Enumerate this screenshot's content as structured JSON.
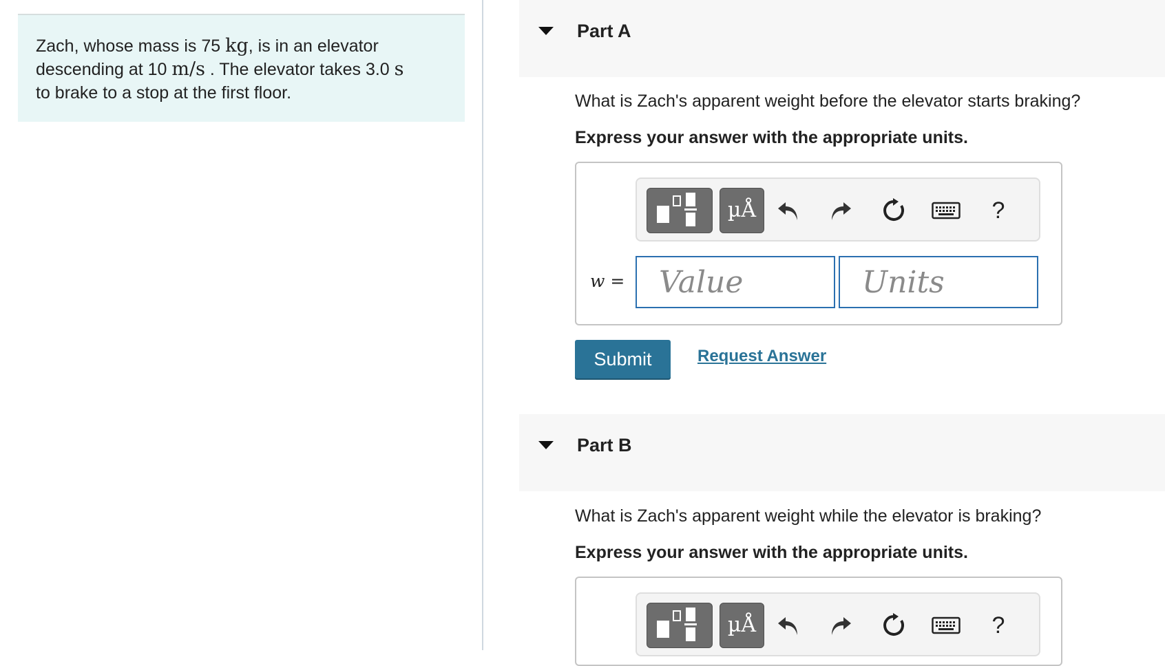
{
  "problem": {
    "t1": "Zach, whose mass is 75",
    "u1": "kg",
    "t2": ", is in an elevator",
    "t3": "descending at 10",
    "u2": "m/s",
    "t4": ". The elevator takes 3.0",
    "u3": "s",
    "t5": "to brake to a stop at the first floor."
  },
  "parts": [
    {
      "title": "Part A",
      "question": "What is Zach's apparent weight before the elevator starts braking?",
      "instruction": "Express your answer with the appropriate units.",
      "variable": "w =",
      "value_placeholder": "Value",
      "units_placeholder": "Units",
      "submit_label": "Submit",
      "request_label": "Request Answer"
    },
    {
      "title": "Part B",
      "question": "What is Zach's apparent weight while the elevator is braking?",
      "instruction": "Express your answer with the appropriate units."
    }
  ],
  "toolbar": {
    "units_button": "µÅ",
    "help_button": "?"
  },
  "icons": [
    "templates-icon",
    "units-icon",
    "undo-icon",
    "redo-icon",
    "reset-icon",
    "keyboard-icon",
    "help-icon",
    "caret-down-icon"
  ],
  "colors": {
    "accent": "#2a7397",
    "problem_bg": "#e8f6f6",
    "field_border": "#2a6fb0"
  }
}
